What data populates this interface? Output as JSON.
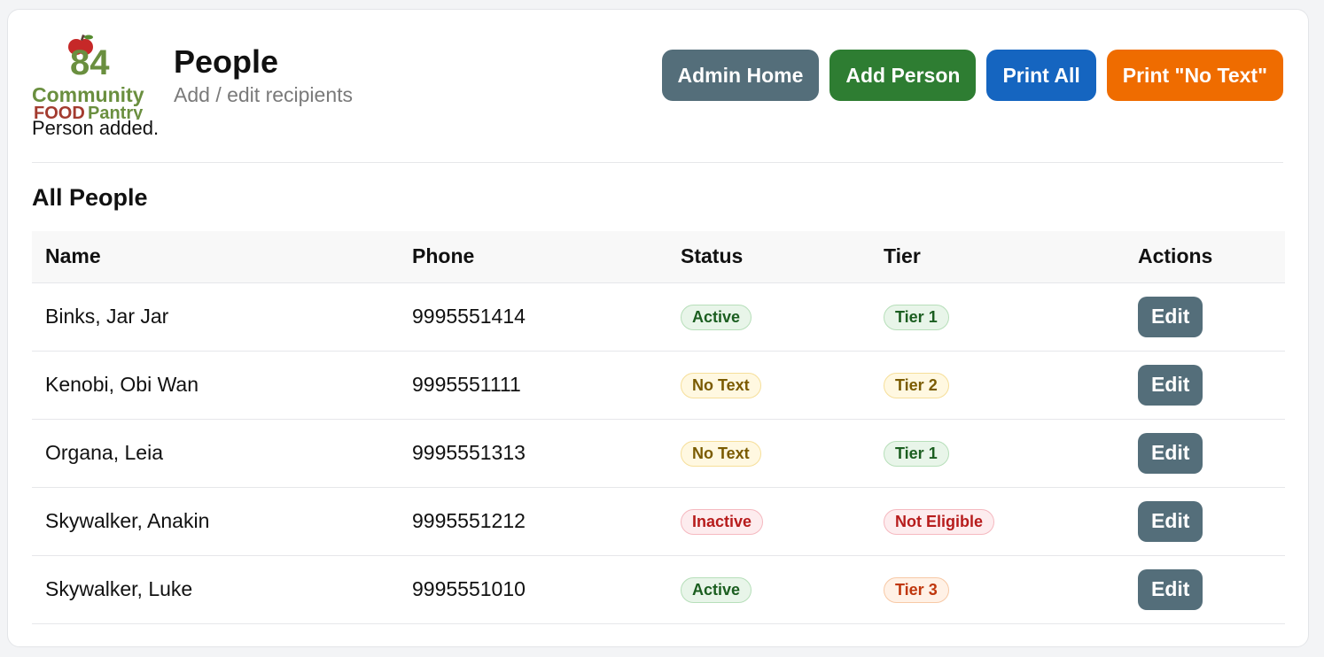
{
  "header": {
    "logo": {
      "number": "84",
      "line1": "Community",
      "line2a": "FOOD",
      "line2b": "Pantry"
    },
    "title": "People",
    "subtitle": "Add / edit recipients",
    "flash": "Person added."
  },
  "buttons": [
    {
      "label": "Admin Home",
      "color": "#546e7a"
    },
    {
      "label": "Add Person",
      "color": "#2e7d32"
    },
    {
      "label": "Print All",
      "color": "#1565c0"
    },
    {
      "label": "Print \"No Text\"",
      "color": "#ef6c00"
    }
  ],
  "section_title": "All People",
  "table": {
    "headers": [
      "Name",
      "Phone",
      "Status",
      "Tier",
      "Actions"
    ],
    "rows": [
      {
        "name": "Binks, Jar Jar",
        "phone": "9995551414",
        "status": "Active",
        "status_style": "green",
        "tier": "Tier 1",
        "tier_style": "green",
        "action": "Edit"
      },
      {
        "name": "Kenobi, Obi Wan",
        "phone": "9995551111",
        "status": "No Text",
        "status_style": "yellow",
        "tier": "Tier 2",
        "tier_style": "yellow",
        "action": "Edit"
      },
      {
        "name": "Organa, Leia",
        "phone": "9995551313",
        "status": "No Text",
        "status_style": "yellow",
        "tier": "Tier 1",
        "tier_style": "green",
        "action": "Edit"
      },
      {
        "name": "Skywalker, Anakin",
        "phone": "9995551212",
        "status": "Inactive",
        "status_style": "red",
        "tier": "Not Eligible",
        "tier_style": "red",
        "action": "Edit"
      },
      {
        "name": "Skywalker, Luke",
        "phone": "9995551010",
        "status": "Active",
        "status_style": "green",
        "tier": "Tier 3",
        "tier_style": "orange",
        "action": "Edit"
      }
    ]
  }
}
